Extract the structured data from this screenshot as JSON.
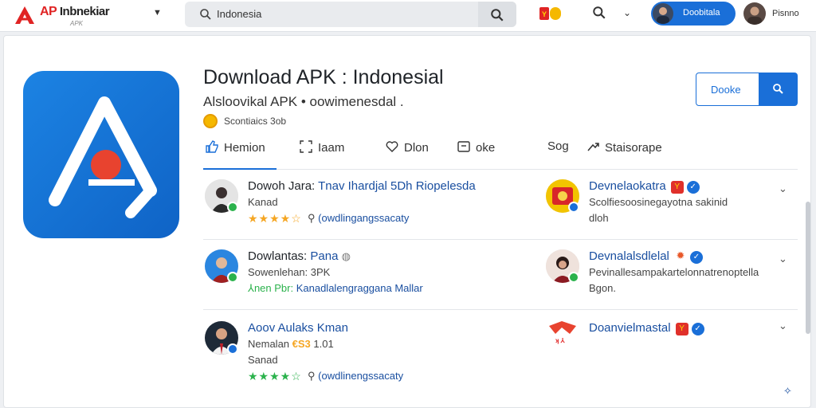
{
  "header": {
    "logo_text": "AP",
    "logo_word": "Inbnekiar",
    "logo_sub": "APK",
    "search_value": "Indonesia",
    "user_chip_label": "Doobitala",
    "user2_label": "Pisnno"
  },
  "app": {
    "title": "Download APK : Indonesial",
    "subtitle": "Alsloovikal APK • oowimenesdal .",
    "meta": "Scontiaics 3ob",
    "download_label": "Dooke"
  },
  "tabs": [
    {
      "label": "Hemion"
    },
    {
      "label": "Iaam"
    },
    {
      "label": "Dlon"
    },
    {
      "label": "oke"
    },
    {
      "label": "Sog"
    },
    {
      "label": "Staisorape"
    }
  ],
  "entries_left": [
    {
      "name_dark": "Dowoh Jara:",
      "name_blue": "Tnav Ihardjal 5Dh Riopelesda",
      "line2": "Kanad",
      "stars": "★★★★☆",
      "line3": "(owdlingangssacaty",
      "badge_color": "#2bb24c"
    },
    {
      "name_dark": "Dowlantas:",
      "name_blue": "Pana",
      "line2": "Sowenlehan: 3PK",
      "line3_green": "⅄nen Pbr:",
      "line3": "Kanadlalengraggana Mallar",
      "badge_color": "#2bb24c"
    },
    {
      "name_dark": "Aoov Aulaks",
      "name_blue": "Kman",
      "line2": "Nemalan",
      "line2_orange": "€S3",
      "line2_tail": "1.01",
      "line2b": "Sanad",
      "stars": "★★★★☆",
      "line3": "(owdlinengssacaty",
      "badge_color": "#1a6fd8"
    }
  ],
  "entries_right": [
    {
      "name": "Devnelaokatra",
      "line2": "Scolfiesoosinegayotna sakinid",
      "line3": "dloh",
      "badge_color": "#1a6fd8"
    },
    {
      "name": "Devnalalsdlelal",
      "line2": "Pevinallesampakartelonnatrenoptella",
      "line3": "Bgon.",
      "badge_color": "#2bb24c"
    },
    {
      "name": "Doanvielmastal",
      "line2": "",
      "line3": ""
    }
  ],
  "colors": {
    "accent": "#1a6fd8",
    "brand_red": "#e02424",
    "star": "#f5a623",
    "star_green": "#2bb24c"
  }
}
